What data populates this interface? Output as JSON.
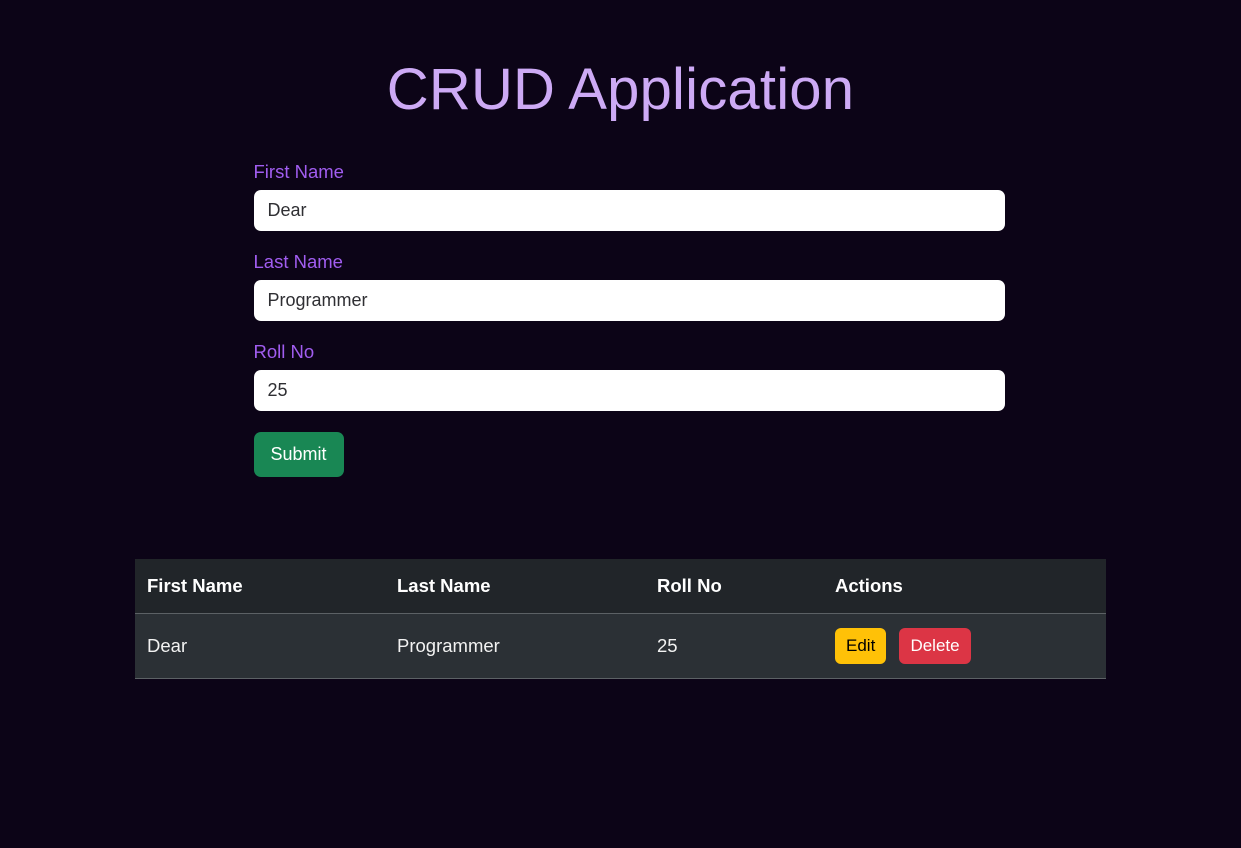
{
  "page": {
    "title": "CRUD Application",
    "background_color": "#0c0417",
    "title_color": "#cdaaf5"
  },
  "form": {
    "label_color": "#a15df0",
    "fields": [
      {
        "label": "First Name",
        "value": "Dear",
        "placeholder": "First Name"
      },
      {
        "label": "Last Name",
        "value": "Programmer",
        "placeholder": "Last Name"
      },
      {
        "label": "Roll No",
        "value": "25",
        "placeholder": "Roll No"
      }
    ],
    "submit_label": "Submit",
    "submit_color": "#198754"
  },
  "table": {
    "header_background": "#212529",
    "row_background": "#2b3035",
    "columns": [
      "First Name",
      "Last Name",
      "Roll No",
      "Actions"
    ],
    "rows": [
      {
        "first_name": "Dear",
        "last_name": "Programmer",
        "roll_no": "25",
        "edit_label": "Edit",
        "delete_label": "Delete"
      }
    ],
    "edit_color": "#ffc107",
    "delete_color": "#dc3545"
  }
}
